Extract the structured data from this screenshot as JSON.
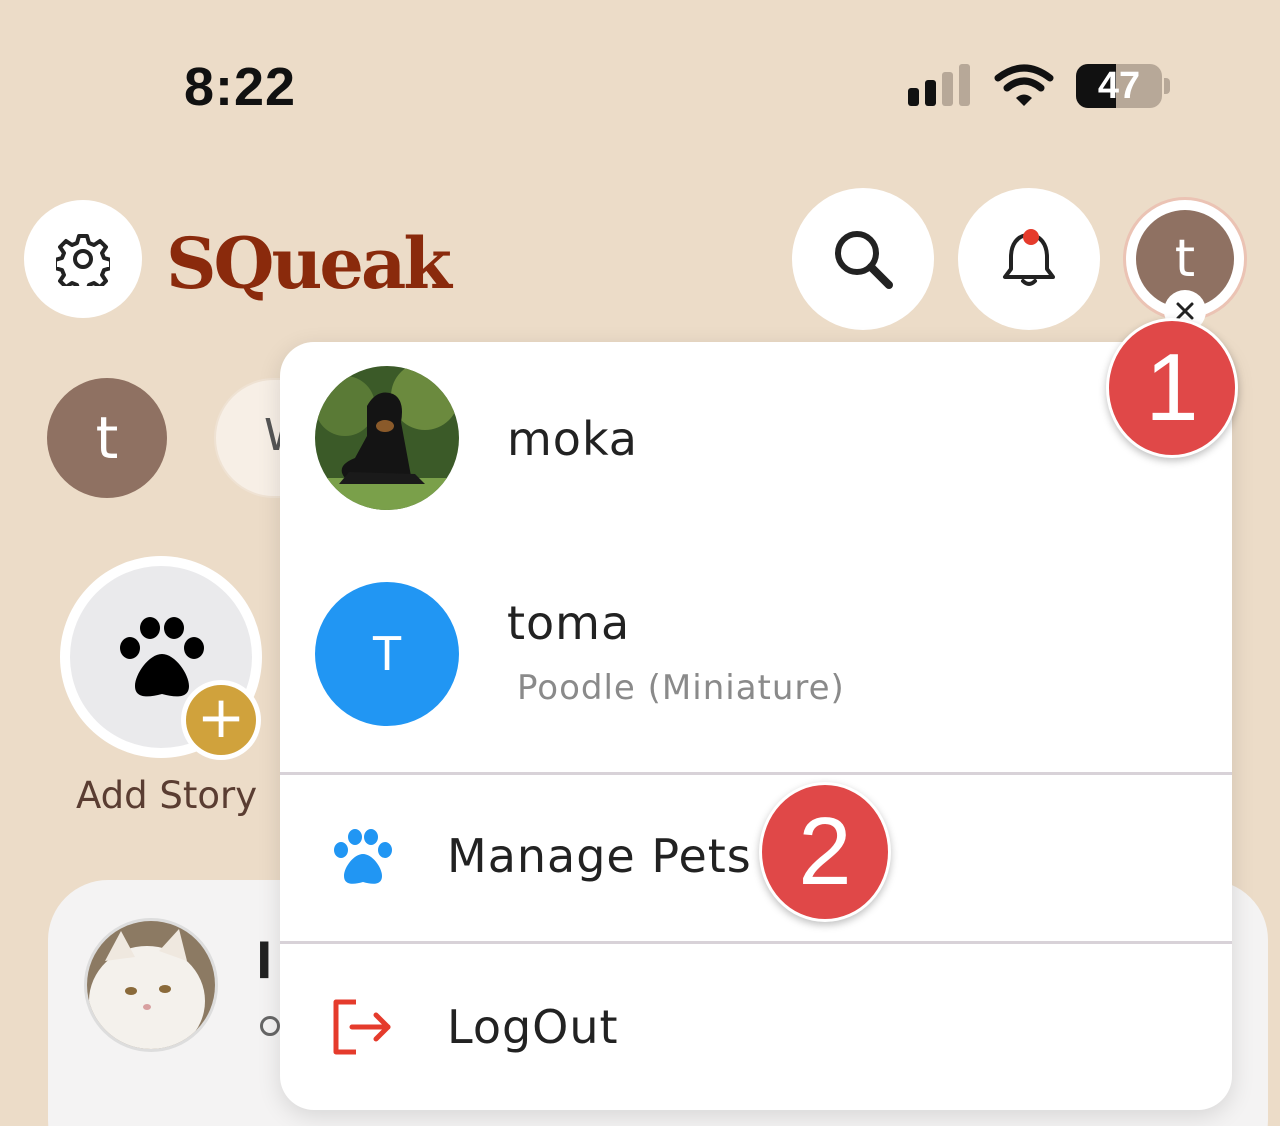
{
  "status_bar": {
    "time": "8:22",
    "battery": "47",
    "battery_level": 0.47
  },
  "header": {
    "app_title": "SQueak",
    "avatar_letter": "t",
    "settings_icon": "gear-icon",
    "search_icon": "search-icon",
    "notifications_icon": "bell-icon"
  },
  "background": {
    "profile_letter": "t",
    "pill_text": "W",
    "add_story_label": "Add Story",
    "card_name": "l"
  },
  "menu": {
    "pets": [
      {
        "name": "moka",
        "breed": ""
      },
      {
        "name": "toma",
        "breed": "Poodle (Miniature)",
        "initial": "T"
      }
    ],
    "manage_pets_label": "Manage Pets",
    "logout_label": "LogOut"
  },
  "annotations": {
    "step1": "1",
    "step2": "2"
  },
  "colors": {
    "background": "#ecdcc8",
    "brand": "#8a2a0c",
    "avatar": "#8f7162",
    "accent_blue": "#2196f3",
    "logout_red": "#e53b2c",
    "badge_red": "#e04848",
    "plus_gold": "#d0a23c"
  }
}
